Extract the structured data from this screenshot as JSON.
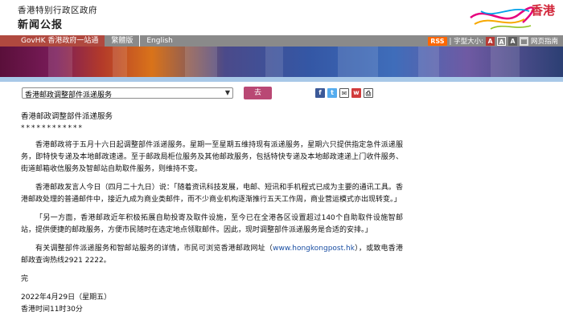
{
  "header": {
    "gov_name": "香港特别行政区政府",
    "site_name": "新闻公报",
    "brand": "香港"
  },
  "nav": {
    "items": [
      {
        "label": "GovHK 香港政府一站通"
      },
      {
        "label": "繁體版"
      },
      {
        "label": "English"
      }
    ],
    "rss": "RSS",
    "font_size_label": "| 字型大小:",
    "size_buttons": [
      "A",
      "A",
      "A"
    ],
    "homepage": "网页指南"
  },
  "toolbar": {
    "select_value": "香港邮政调整部件派递服务",
    "go_label": "去",
    "share_icons": [
      "facebook-icon",
      "twitter-icon",
      "email-icon",
      "weibo-icon",
      "print-icon"
    ]
  },
  "article": {
    "title": "香港邮政调整部件派递服务",
    "stars": "************",
    "paragraphs": [
      "香港邮政将于五月十六日起调整部件派递服务。星期一至星期五维持现有派递服务，星期六只提供指定急件派递服务，即特快专递及本地邮政速递。至于邮政局柜位服务及其他邮政服务，包括特快专递及本地邮政速递上门收件服务、街道邮箱收信服务及智邮站自助取件服务，则维持不变。",
      "香港邮政发言人今日（四月二十九日）说：「随着资讯科技发展，电邮、短讯和手机程式已成为主要的通讯工具。香港邮政处理的普通邮件中，接近九成为商业类邮件，而不少商业机构逐渐推行五天工作周，商业营运模式亦出现转变。」",
      "「另一方面，香港邮政近年积极拓展自助投寄及取件设施，至今已在全港各区设置超过140个自助取件设施智邮站，提供便捷的邮政服务，方便市民随时在选定地点领取邮件。因此，现时调整部件派递服务是合适的安排。」"
    ],
    "last_para_before": "有关调整部件派递服务和智邮站服务的详情，市民可浏览香港邮政网址（",
    "link_text": "www.hongkongpost.hk",
    "last_para_after": "），或致电香港邮政查询热线2921 2222。",
    "end": "完",
    "date": "2022年4月29日（星期五）",
    "time": "香港时间11时30分"
  }
}
